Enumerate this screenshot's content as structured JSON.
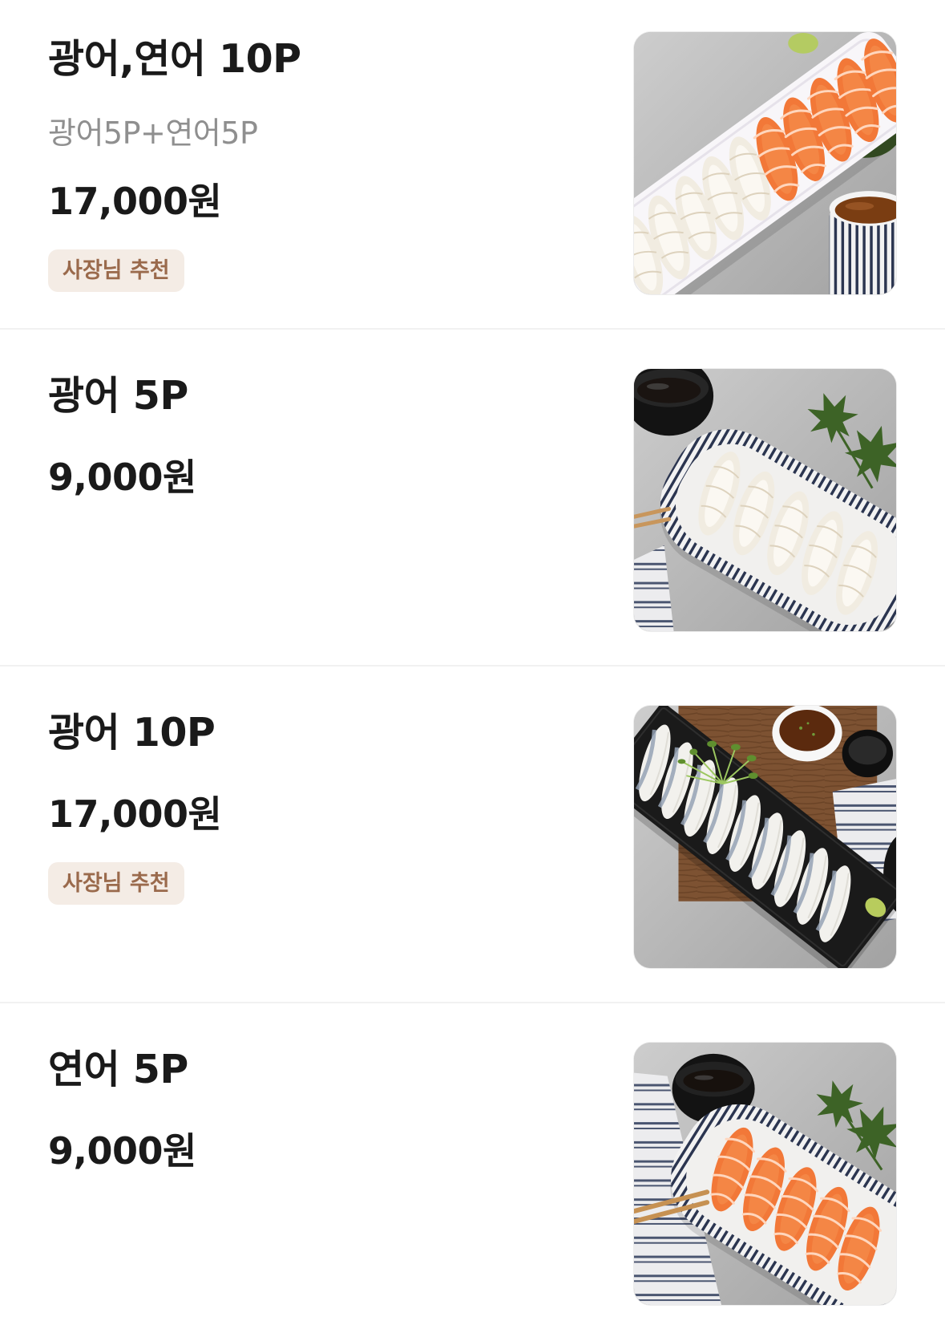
{
  "menu": [
    {
      "name": "광어,연어 10P",
      "description": "광어5P+연어5P",
      "price": "17,000원",
      "badge": "사장님 추천"
    },
    {
      "name": "광어 5P",
      "price": "9,000원"
    },
    {
      "name": "광어 10P",
      "price": "17,000원",
      "badge": "사장님 추천"
    },
    {
      "name": "연어 5P",
      "price": "9,000원"
    }
  ],
  "colors": {
    "text": "#1a1a1a",
    "description": "#8f8f8f",
    "badge_background": "#f4ece5",
    "badge_text": "#9a6a4c",
    "divider": "#f1f1f1"
  }
}
